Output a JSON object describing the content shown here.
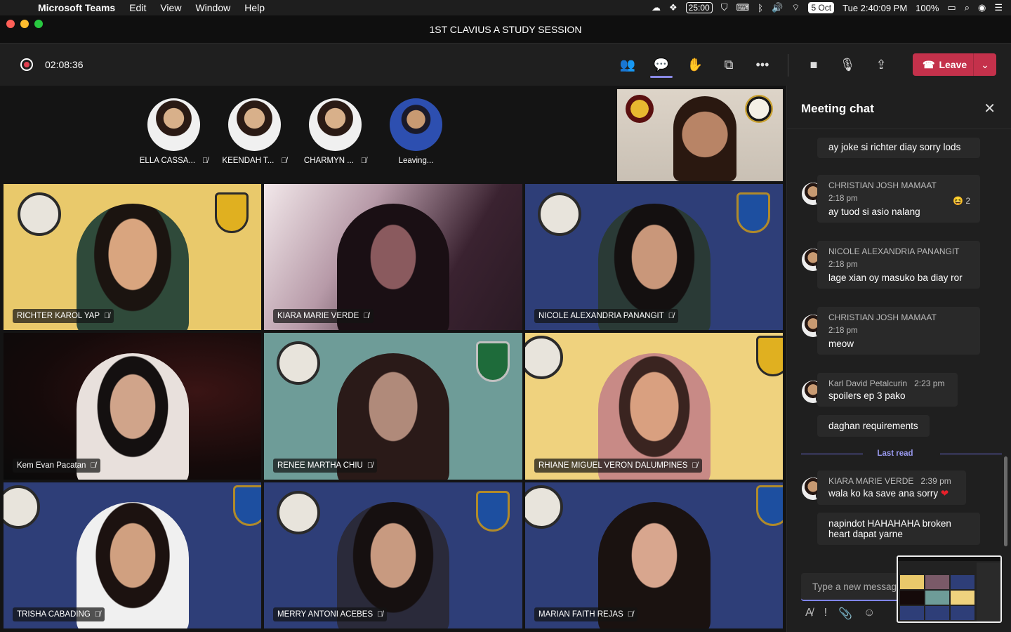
{
  "menubar": {
    "app": "Microsoft Teams",
    "items": [
      "Edit",
      "View",
      "Window",
      "Help"
    ],
    "timer": "25:00",
    "date_badge": "5 Oct",
    "clock": "Tue 2:40:09 PM",
    "battery": "100%"
  },
  "window": {
    "title": "1ST CLAVIUS A STUDY SESSION"
  },
  "toolbar": {
    "duration": "02:08:36",
    "leave_label": "Leave"
  },
  "participants_row": [
    {
      "name": "ELLA CASSA..."
    },
    {
      "name": "KEENDAH T..."
    },
    {
      "name": "CHARMYN ..."
    },
    {
      "name": "Leaving..."
    }
  ],
  "tiles": [
    {
      "name": "RICHTER KAROL YAP"
    },
    {
      "name": "KIARA MARIE VERDE"
    },
    {
      "name": "NICOLE ALEXANDRIA PANANGIT"
    },
    {
      "name": "Kem Evan Pacatan"
    },
    {
      "name": "RENEE MARTHA CHIU"
    },
    {
      "name": "RHIANE MIGUEL VERON DALUMPINES"
    },
    {
      "name": "TRISHA CABADING"
    },
    {
      "name": "MERRY ANTONI ACEBES"
    },
    {
      "name": "MARIAN FAITH REJAS"
    }
  ],
  "chat": {
    "title": "Meeting chat",
    "messages": [
      {
        "text": "ay joke si richter diay sorry lods"
      },
      {
        "author": "CHRISTIAN JOSH MAMAAT",
        "time": "2:18 pm",
        "text": "ay tuod si asio nalang",
        "reaction_count": "2"
      },
      {
        "author": "NICOLE ALEXANDRIA PANANGIT",
        "time": "2:18 pm",
        "text": "lage xian oy masuko ba diay ror"
      },
      {
        "author": "CHRISTIAN JOSH MAMAAT",
        "time": "2:18 pm",
        "text": "meow"
      },
      {
        "author": "Karl David Petalcurin",
        "time": "2:23 pm",
        "text": "spoilers ep 3 pako"
      },
      {
        "text": "daghan requirements"
      },
      {
        "author": "KIARA MARIE VERDE",
        "time": "2:39 pm",
        "text": "wala ko ka save ana sorry"
      },
      {
        "text": "napindot HAHAHAHA broken heart dapat yarne"
      }
    ],
    "last_read": "Last read",
    "compose_placeholder": "Type a new messag"
  }
}
